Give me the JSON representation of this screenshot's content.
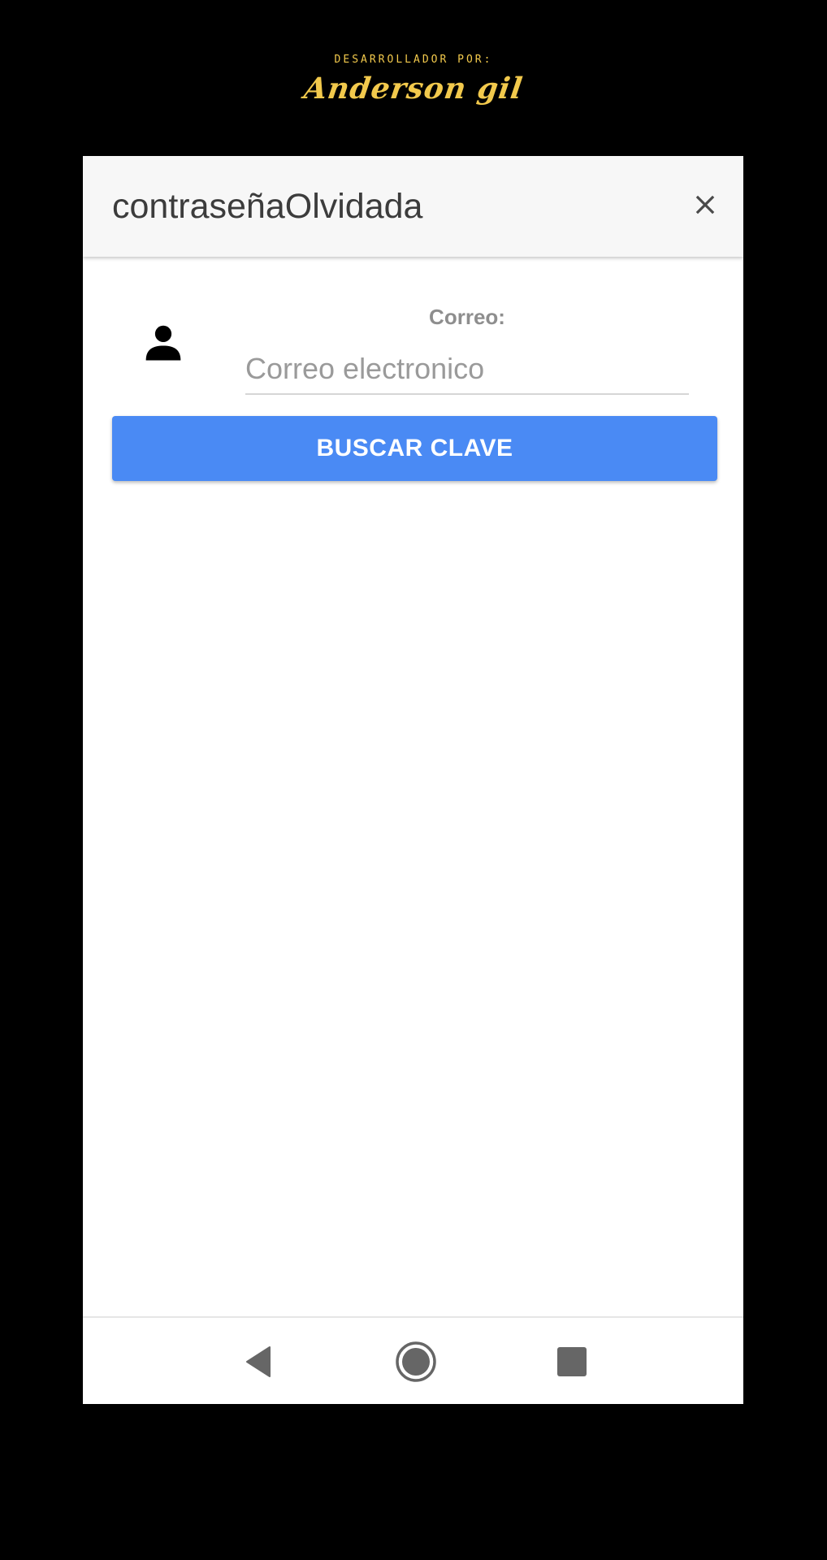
{
  "credit": {
    "small": "DESARROLLADOR POR:",
    "name": "Anderson gil"
  },
  "dialog": {
    "title": "contraseñaOlvidada",
    "close_icon": "close-icon"
  },
  "form": {
    "user_icon": "person-icon",
    "email_label": "Correo:",
    "email_placeholder": "Correo electronico",
    "email_value": ""
  },
  "actions": {
    "search_label": "BUSCAR CLAVE"
  },
  "navbar": {
    "back_icon": "back-triangle-icon",
    "home_icon": "home-circle-icon",
    "recent_icon": "recent-apps-square-icon"
  },
  "colors": {
    "background": "#000000",
    "credit": "#f2c94c",
    "header": "#f7f7f7",
    "button": "#4a8af4",
    "icon": "#666666"
  }
}
